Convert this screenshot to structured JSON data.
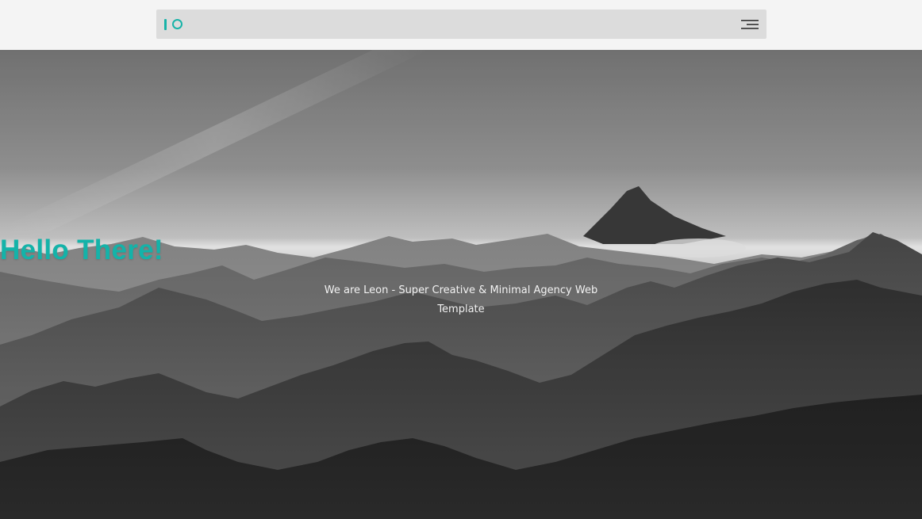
{
  "header": {
    "logo_icon": "io-logo-icon",
    "menu_icon": "hamburger-menu-icon",
    "accent_color": "#17b3a8"
  },
  "hero": {
    "background": "grayscale-mountain-range-image",
    "title": "Hello There!",
    "subtitle": "We are Leon - Super Creative & Minimal Agency Web Template",
    "title_color": "#14b3a9"
  }
}
